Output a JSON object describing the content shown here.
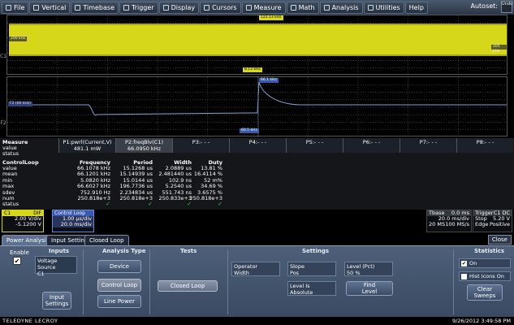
{
  "menu": {
    "items": [
      {
        "label": "File",
        "icon": "file-icon"
      },
      {
        "label": "Vertical",
        "icon": "vertical-icon"
      },
      {
        "label": "Timebase",
        "icon": "timebase-icon"
      },
      {
        "label": "Trigger",
        "icon": "trigger-icon"
      },
      {
        "label": "Display",
        "icon": "display-icon"
      },
      {
        "label": "Cursors",
        "icon": "cursors-icon"
      },
      {
        "label": "Measure",
        "icon": "measure-icon"
      },
      {
        "label": "Math",
        "icon": "math-icon"
      },
      {
        "label": "Analysis",
        "icon": "analysis-icon"
      },
      {
        "label": "Utilities",
        "icon": "utilities-icon"
      },
      {
        "label": "Help",
        "icon": ""
      }
    ],
    "autoset": "Autoset:",
    "undo": "Undo"
  },
  "waveform1": {
    "label_top": "122.13 kHz",
    "label_bottom": "8.13 kHz",
    "left_tag": "200 kHz",
    "right_tag": "205 kHz",
    "channel": "C1",
    "trace_color": "#d6d61a"
  },
  "waveform2": {
    "label_top": "66.1 kHz",
    "label_bottom": "60.5 kHz",
    "left_tag": "F2 (66 kHz)",
    "channel": "F2",
    "trace_color": "#8aa0d0"
  },
  "measure": {
    "title": "Measure",
    "row_labels": [
      "value",
      "status"
    ],
    "params": [
      {
        "name": "P1:pwrl(Current,V)",
        "value": "481.1 mW"
      },
      {
        "name": "P2:freqBlv(C1)",
        "value": "66.0950 kHz"
      },
      {
        "name": "P3:- - -",
        "value": ""
      },
      {
        "name": "P4:- - -",
        "value": ""
      },
      {
        "name": "P5:- - -",
        "value": ""
      },
      {
        "name": "P6:- - -",
        "value": ""
      },
      {
        "name": "P7:- - -",
        "value": ""
      },
      {
        "name": "P8:- - -",
        "value": ""
      }
    ],
    "stats_title": "ControlLoop",
    "stats_headers": [
      "Frequency",
      "Period",
      "Width",
      "Duty"
    ],
    "stats_rows": [
      {
        "label": "value",
        "cells": [
          "66.1078 kHz",
          "15.1268 us",
          "2.0889 us",
          "13.81 %"
        ]
      },
      {
        "label": "mean",
        "cells": [
          "66.1201 kHz",
          "15.14939 us",
          "2.481440 us",
          "16.4114 %"
        ]
      },
      {
        "label": "min",
        "cells": [
          "5.0820 kHz",
          "15.0144 us",
          "102.9 ns",
          "52 m%"
        ]
      },
      {
        "label": "max",
        "cells": [
          "66.6027 kHz",
          "196.7736 us",
          "5.2540 us",
          "34.69 %"
        ]
      },
      {
        "label": "sdev",
        "cells": [
          "752.910 Hz",
          "2.234834 us",
          "551.743 ns",
          "3.6575 %"
        ]
      },
      {
        "label": "num",
        "cells": [
          "250.818e+3",
          "250.818e+3",
          "250.833e+3",
          "250.818e+3"
        ]
      },
      {
        "label": "status",
        "cells": [
          "✓",
          "✓",
          "✓",
          "✓"
        ]
      }
    ]
  },
  "channel": {
    "name": "C1",
    "coupling": "DIF",
    "vdiv": "2.00 V/div",
    "offset": "-5.1200 V"
  },
  "control_loop": {
    "name": "Control Loop",
    "tdiv": "1.00 µs/div",
    "vdiv": "20.0 ms/div"
  },
  "timebase": {
    "label": "Tbase",
    "delay": "0.0 ms",
    "tdiv": "20.0 ms/div",
    "samples": "20 MS",
    "rate": "100 MS/s"
  },
  "trigger": {
    "label": "Trigger",
    "src": "C1 DC",
    "mode": "Stop",
    "level": "5.20 V",
    "edge": "Edge",
    "slope": "Positive"
  },
  "tabs": [
    {
      "label": "Power Analysis",
      "active": true
    },
    {
      "label": "Input Settings",
      "active": false
    },
    {
      "label": "Closed Loop",
      "active": false
    }
  ],
  "close_label": "Close",
  "dialog": {
    "enable_label": "Enable",
    "inputs_title": "Inputs",
    "voltage_source_label": "Voltage Source",
    "voltage_source_value": "C1",
    "input_settings_label": "Input Settings",
    "analysis_type_title": "Analysis Type",
    "device_label": "Device",
    "control_loop_label": "Control Loop",
    "line_power_label": "Line Power",
    "tests_title": "Tests",
    "closed_loop_label": "Closed Loop",
    "settings_title": "Settings",
    "operator_label": "Operator",
    "operator_value": "Width",
    "slope_label": "Slope",
    "slope_value": "Pos",
    "level_label": "Level (Pct)",
    "level_value": "50 %",
    "level_is_label": "Level Is",
    "level_is_value": "Absolute",
    "find_level_label": "Find Level",
    "statistics_title": "Statistics",
    "on_label": "On",
    "hist_icons_label": "Hist Icons On",
    "clear_sweeps_label": "Clear Sweeps"
  },
  "status": {
    "brand": "TELEDYNE LECROY",
    "datetime": "9/26/2012 3:49:58 PM"
  }
}
